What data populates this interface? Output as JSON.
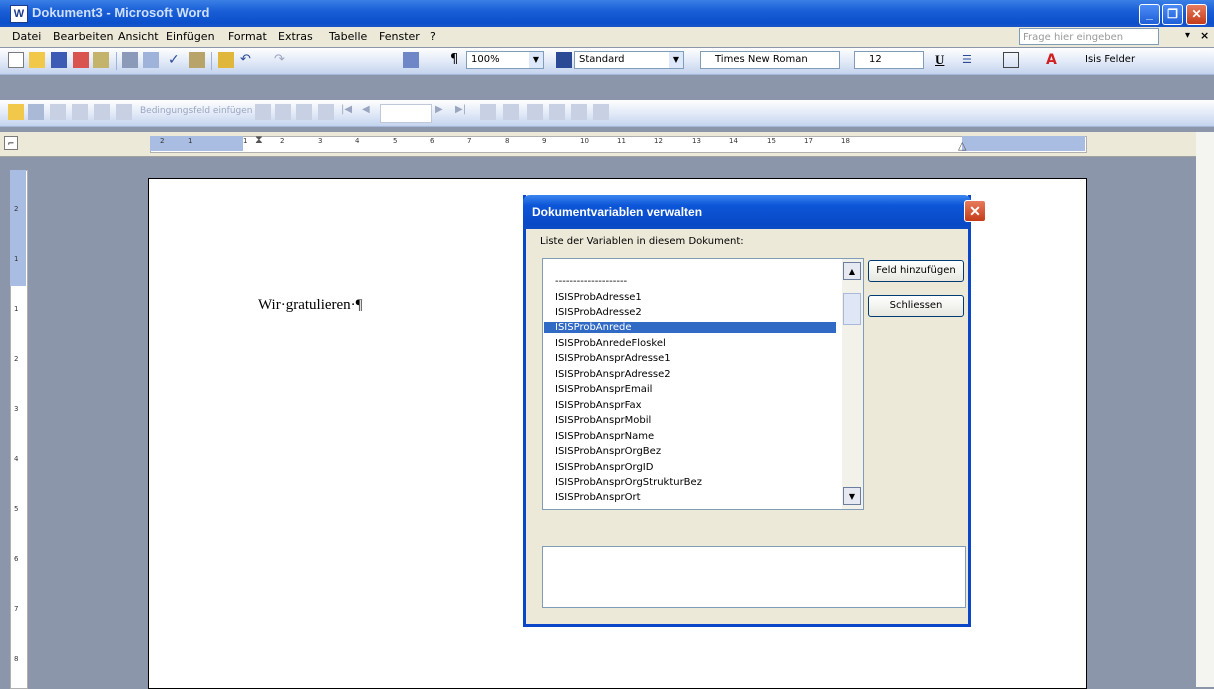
{
  "window": {
    "title": "Dokument3 - Microsoft Word"
  },
  "menu": {
    "items": [
      "Datei",
      "Bearbeiten",
      "Ansicht",
      "Einfügen",
      "Format",
      "Extras",
      "Tabelle",
      "Fenster",
      "?"
    ],
    "ask_placeholder": "Frage hier eingeben"
  },
  "formatting": {
    "zoom": "100%",
    "style": "Standard",
    "font": "Times New Roman",
    "size": "12",
    "isis_label": "Isis Felder"
  },
  "mailmerge_toolbar": {
    "insert_field_label": "Bedingungsfeld einfügen"
  },
  "ruler": {
    "h_ticks": [
      "2",
      "1",
      "1",
      "2",
      "3",
      "4",
      "5",
      "6",
      "7",
      "8",
      "9",
      "10",
      "11",
      "12",
      "13",
      "14",
      "15",
      "17",
      "18"
    ],
    "v_ticks": [
      "2",
      "1",
      "1",
      "2",
      "3",
      "4",
      "5",
      "6",
      "7",
      "8"
    ]
  },
  "document": {
    "text": "Wir·gratulieren·¶"
  },
  "dialog": {
    "title": "Dokumentvariablen verwalten",
    "list_label": "Liste der Variablen in diesem Dokument:",
    "items": [
      "--------------------",
      "ISISProbAdresse1",
      "ISISProbAdresse2",
      "ISISProbAnrede",
      "ISISProbAnredeFloskel",
      "ISISProbAnsprAdresse1",
      "ISISProbAnsprAdresse2",
      "ISISProbAnsprEmail",
      "ISISProbAnsprFax",
      "ISISProbAnsprMobil",
      "ISISProbAnsprName",
      "ISISProbAnsprOrgBez",
      "ISISProbAnsprOrgID",
      "ISISProbAnsprOrgStrukturBez",
      "ISISProbAnsprOrt"
    ],
    "selected_index": 3,
    "add_field_button": "Feld hinzufügen",
    "close_button": "Schliessen",
    "description": ""
  }
}
